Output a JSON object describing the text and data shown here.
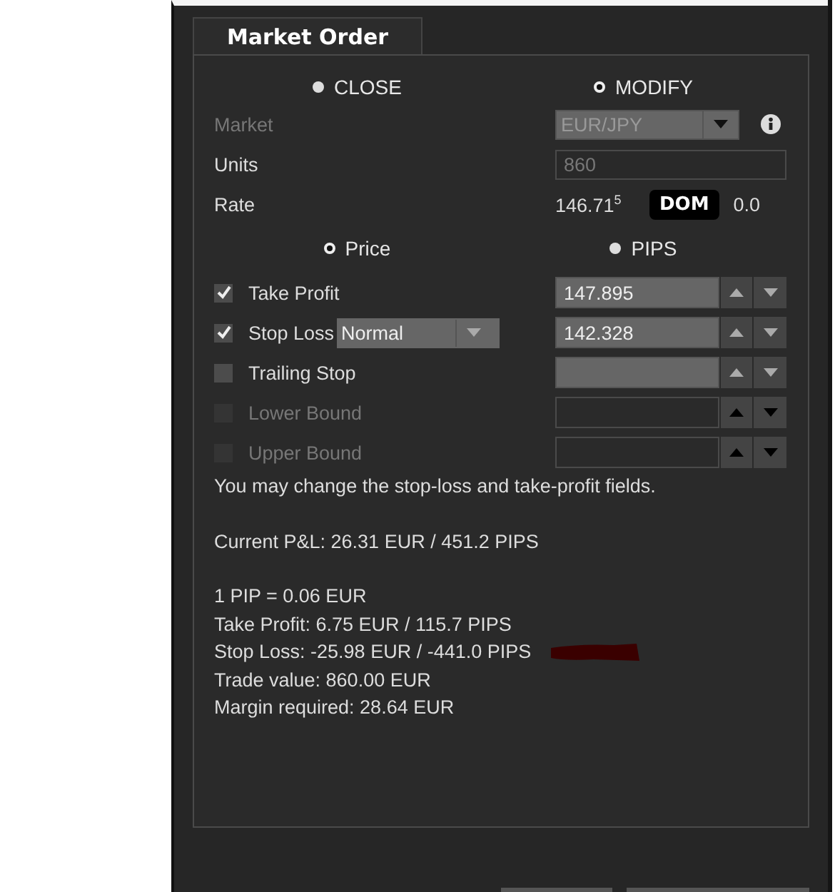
{
  "tab": {
    "label": "Market Order",
    "selected": true
  },
  "mode_options": [
    {
      "label": "CLOSE",
      "selected": false
    },
    {
      "label": "MODIFY",
      "selected": true
    }
  ],
  "market": {
    "label": "Market",
    "value": "EUR/JPY",
    "disabled": true
  },
  "units": {
    "label": "Units",
    "value": "860"
  },
  "rate": {
    "label": "Rate",
    "value": "146.71$^{5}$",
    "button": "DOM",
    "spread": "0.0"
  },
  "unit_options": [
    {
      "label": "Price",
      "selected": true
    },
    {
      "label": "PIPS",
      "selected": false
    }
  ],
  "orders": [
    {
      "kind": "price",
      "label": "Take Profit",
      "checked": true,
      "disabled": false,
      "value": "147.895"
    },
    {
      "kind": "stop",
      "label": "Stop Loss",
      "checked": true,
      "disabled": false,
      "stop_type": "Normal",
      "value": "142.328"
    },
    {
      "kind": "price",
      "label": "Trailing Stop",
      "checked": false,
      "disabled": false
    },
    {
      "kind": "price",
      "label": "Lower Bound",
      "checked": false,
      "disabled": true
    },
    {
      "kind": "price",
      "label": "Upper Bound",
      "checked": false,
      "disabled": true
    }
  ],
  "note": "You may change the stop-loss and take-profit fields.",
  "current_pl": "Current P&L: 26.31 EUR / 451.2 PIPS",
  "details": [
    {
      "text": "1 PIP = 0.06 EUR",
      "redacted": false
    },
    {
      "text": "Take Profit: 6.75 EUR / 115.7 PIPS",
      "redacted": false
    },
    {
      "text": "Stop Loss: -25.98 EUR / -441.0 PIPS",
      "redacted": true
    },
    {
      "text": "Trade value: 860.00 EUR",
      "redacted": false
    },
    {
      "text": "Margin required: 28.64 EUR",
      "redacted": false
    }
  ]
}
